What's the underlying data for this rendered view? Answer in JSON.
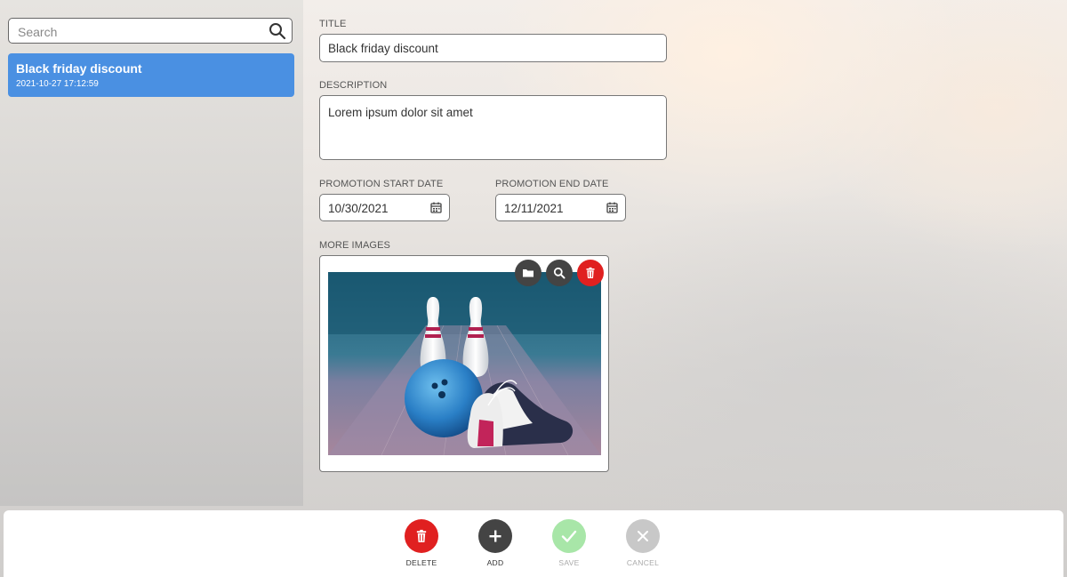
{
  "sidebar": {
    "search_placeholder": "Search",
    "items": [
      {
        "title": "Black friday discount",
        "date": "2021-10-27 17:12:59",
        "selected": true
      }
    ]
  },
  "form": {
    "title_label": "TITLE",
    "title_value": "Black friday discount",
    "description_label": "DESCRIPTION",
    "description_value": "Lorem ipsum dolor sit amet",
    "start_label": "PROMOTION START DATE",
    "start_value": "10/30/2021",
    "end_label": "PROMOTION END DATE",
    "end_value": "12/11/2021",
    "images_label": "MORE IMAGES"
  },
  "image_actions": [
    {
      "icon": "folder-icon",
      "color": "#444444"
    },
    {
      "icon": "search-icon",
      "color": "#444444"
    },
    {
      "icon": "trash-icon",
      "color": "#e02020"
    }
  ],
  "footer": {
    "delete_label": "DELETE",
    "add_label": "ADD",
    "save_label": "SAVE",
    "cancel_label": "CANCEL"
  },
  "colors": {
    "accent": "#4a90e2",
    "delete": "#e02020",
    "add": "#444444",
    "save_disabled": "#a8e6a8",
    "cancel_disabled": "#c8c8c8"
  }
}
